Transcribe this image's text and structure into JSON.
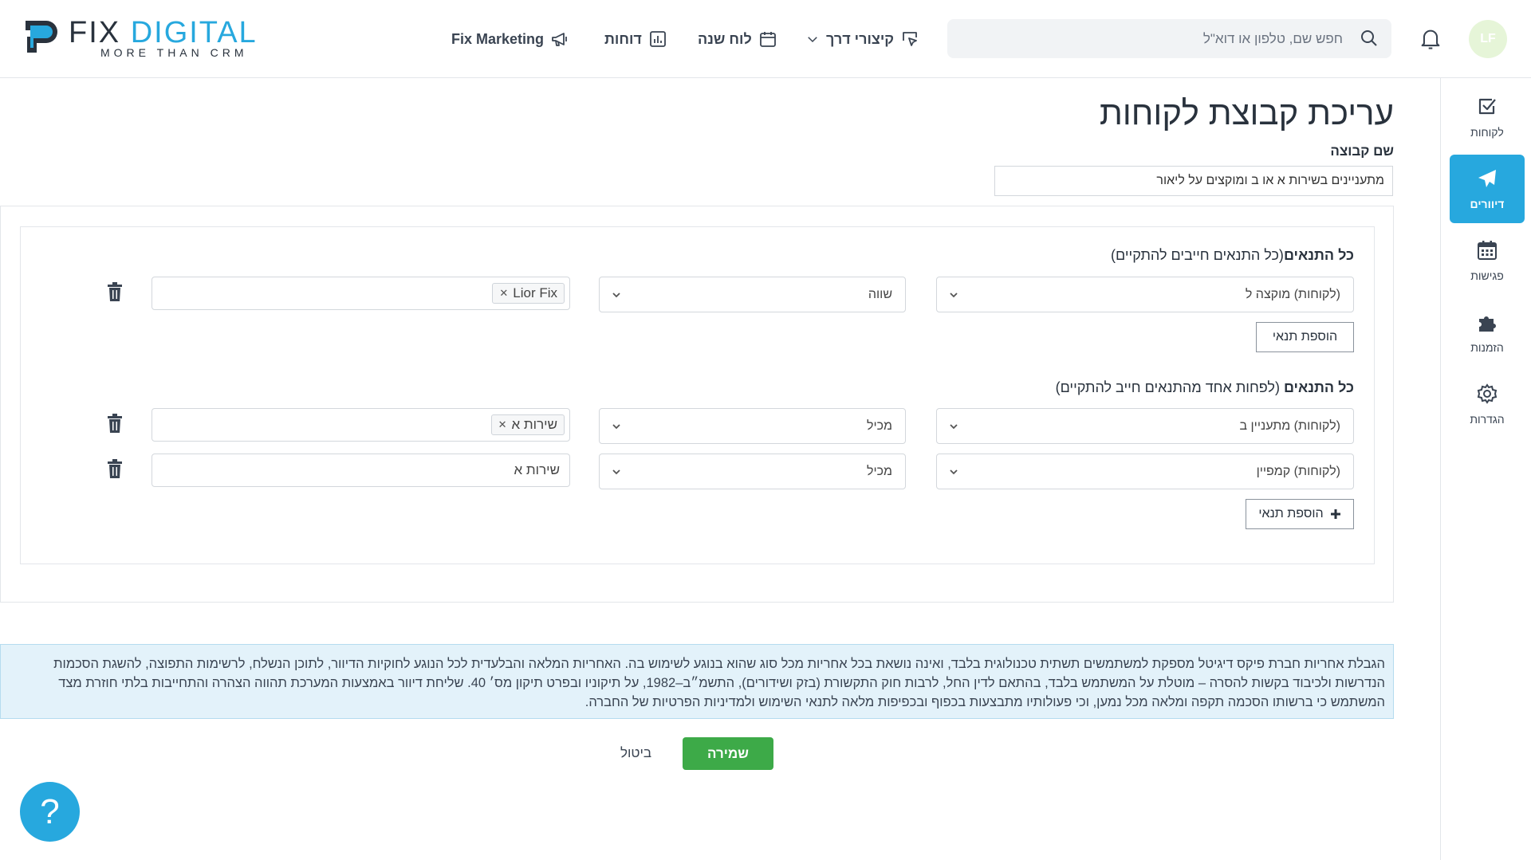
{
  "brand": {
    "name_part1": "FIX",
    "name_part2": "DIGITAL",
    "tagline": "MORE THAN CRM",
    "color_primary": "#27a8de",
    "color_dark": "#29323d"
  },
  "header": {
    "nav": [
      {
        "label": "Fix Marketing",
        "icon": "megaphone-icon"
      },
      {
        "label": "דוחות",
        "icon": "bar-chart-icon"
      },
      {
        "label": "לוח שנה",
        "icon": "calendar-icon"
      },
      {
        "label": "קיצורי דרך",
        "icon": "cursor-icon",
        "has_dropdown": true
      }
    ],
    "search_placeholder": "חפש שם, טלפון או דוא\"ל",
    "avatar_initials": "LF",
    "avatar_color": "#e6f5d8"
  },
  "sidebar": {
    "items": [
      {
        "label": "לקוחות",
        "icon": "checkbox-icon",
        "active": false
      },
      {
        "label": "דיוורים",
        "icon": "paper-plane-icon",
        "active": true
      },
      {
        "label": "פגישות",
        "icon": "calendar-grid-icon",
        "active": false
      },
      {
        "label": "הזמנות",
        "icon": "puzzle-icon",
        "active": false
      },
      {
        "label": "הגדרות",
        "icon": "gear-icon",
        "active": false
      }
    ]
  },
  "main": {
    "title": "עריכת קבוצת לקוחות",
    "group_name_label": "שם קבוצה",
    "group_name_value": "מתעניינים בשירות א או ב ומוקצים על ליאור",
    "all_conditions": {
      "title_bold": "כל התנאים",
      "title_rest": "(כל התנאים חייבים להתקיים)",
      "rows": [
        {
          "field": "(לקוחות) מוקצה ל",
          "operator": "שווה",
          "value_tag": "Lior Fix"
        }
      ],
      "add_label": "הוספת תנאי"
    },
    "any_conditions": {
      "title_bold": "כל התנאים",
      "title_rest": " (לפחות אחד מהתנאים חייב להתקיים)",
      "rows": [
        {
          "field": "(לקוחות) מתעניין ב",
          "operator": "מכיל",
          "value_tag": "שירות א"
        },
        {
          "field": "(לקוחות) קמפיין",
          "operator": "מכיל",
          "value_text": "שירות א"
        }
      ],
      "add_label": "הוספת תנאי"
    },
    "disclaimer": "הגבלת אחריות חברת פיקס דיגיטל מספקת למשתמשים תשתית טכנולוגית בלבד, ואינה נושאת בכל אחריות מכל סוג שהוא בנוגע לשימוש בה. האחריות המלאה והבלעדית לכל הנוגע לחוקיות הדיוור, לתוכן הנשלח, לרשימות התפוצה, להשגת הסכמות הנדרשות ולכיבוד בקשות להסרה – מוטלת על המשתמש בלבד, בהתאם לדין החל, לרבות חוק התקשורת (בזק ושידורים), התשמ״ב–1982, על תיקוניו ובפרט תיקון מס׳ 40. שליחת דיוור באמצעות המערכת תהווה הצהרה והתחייבות בלתי חוזרת מצד המשתמש כי ברשותו הסכמה תקפה ומלאה מכל נמען, וכי פעולותיו מתבצעות בכפוף ובכפיפות מלאה לתנאי השימוש ולמדיניות הפרטיות של החברה.",
    "save_label": "שמירה",
    "cancel_label": "ביטול",
    "help_label": "?",
    "save_color": "#3daa48"
  }
}
